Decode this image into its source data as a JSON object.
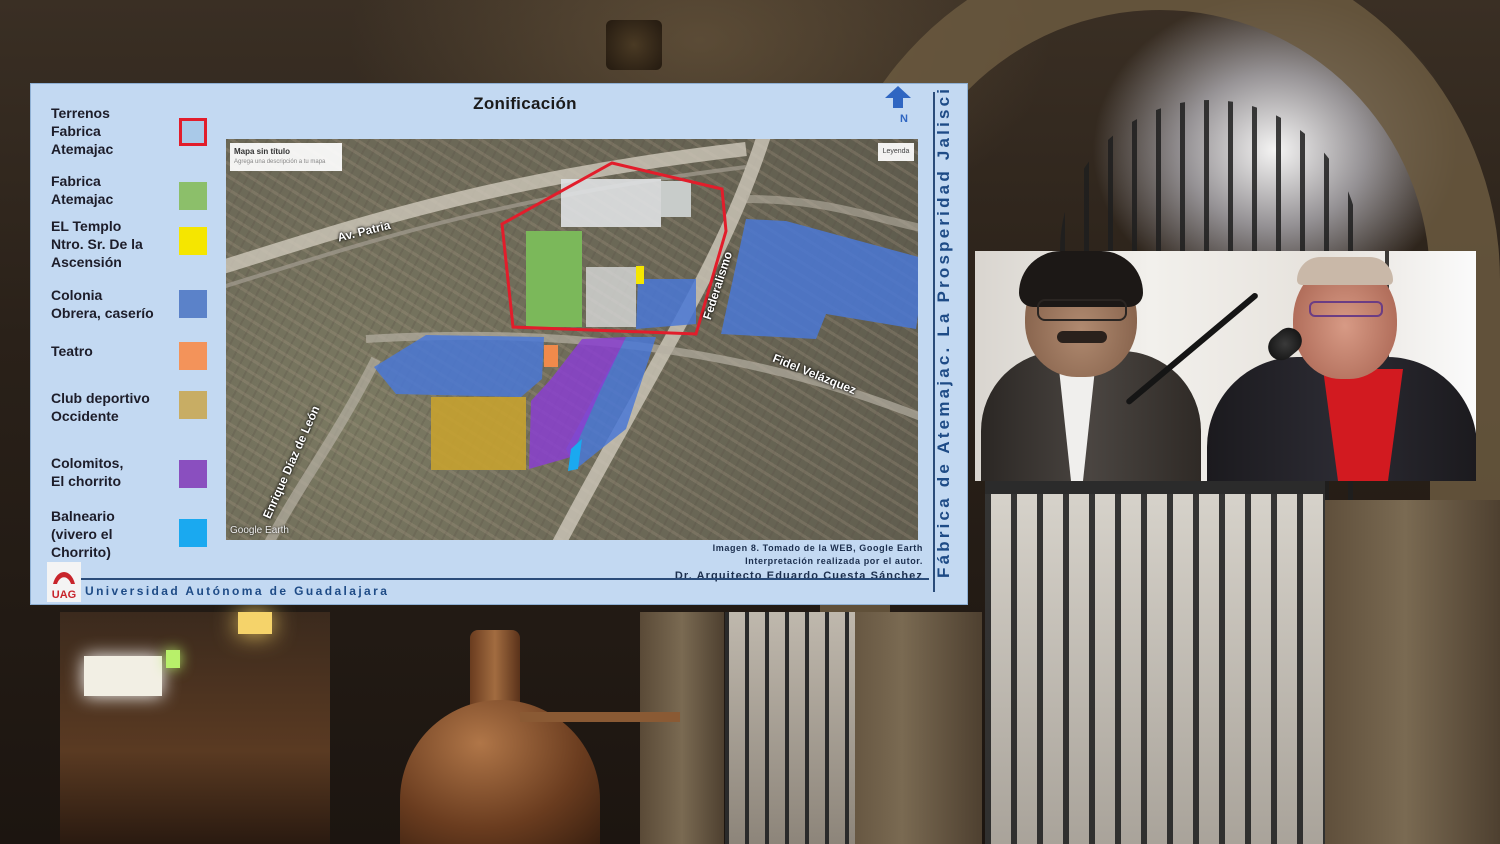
{
  "slide": {
    "title": "Zonificación",
    "vertical_title": "Fábrica de Atemajac. La Prosperidad Jaliscien",
    "university": "Universidad Autónoma de Guadalajara",
    "logo_text": "UAG",
    "credit_line1": "Imagen 8. Tomado de la WEB, Google Earth",
    "credit_line2": "Interpretación realizada por el autor.",
    "credit_line3": "Dr. Arquitecto Eduardo Cuesta Sánchez",
    "north_label": "N",
    "legend": [
      {
        "label": "Terrenos\nFabrica\nAtemajac",
        "color": "#e21d2b",
        "style": "outline"
      },
      {
        "label": "Fabrica\nAtemajac",
        "color": "#8cbf6a",
        "style": "fill"
      },
      {
        "label": "EL Templo\nNtro. Sr. De la\nAscensión",
        "color": "#f5e600",
        "style": "fill"
      },
      {
        "label": "Colonia\nObrera, caserío",
        "color": "#5b82c9",
        "style": "fill"
      },
      {
        "label": "Teatro",
        "color": "#f3935a",
        "style": "fill"
      },
      {
        "label": "Club deportivo\nOccidente",
        "color": "#c8ad64",
        "style": "fill"
      },
      {
        "label": "Colomitos,\nEl chorrito",
        "color": "#8a4fbf",
        "style": "fill"
      },
      {
        "label": "Balneario\n(vivero el\nChorrito)",
        "color": "#1aa9f0",
        "style": "fill"
      }
    ],
    "map": {
      "card_title": "Mapa sin título",
      "card_subtitle": "Agrega una descripción a tu mapa",
      "legend_button": "Leyenda",
      "watermark": "Google Earth",
      "streets": {
        "av_patria": "Av. Patria",
        "federalismo": "Federalismo",
        "fidel_velazquez": "Fidel Velázquez",
        "enrique_diaz": "Enrique Díaz de León"
      },
      "colors": {
        "fabrica_outline": "#e21d2b",
        "fabrica": "#77b255",
        "templo": "#f5e600",
        "colonia": "#4a78d6",
        "teatro": "#f08a4b",
        "club": "#c7a230",
        "colomitos": "#8a3fd0",
        "balneario": "#1aa9f0"
      }
    }
  },
  "video": {
    "participants": [
      "speaker-left",
      "speaker-right"
    ]
  }
}
